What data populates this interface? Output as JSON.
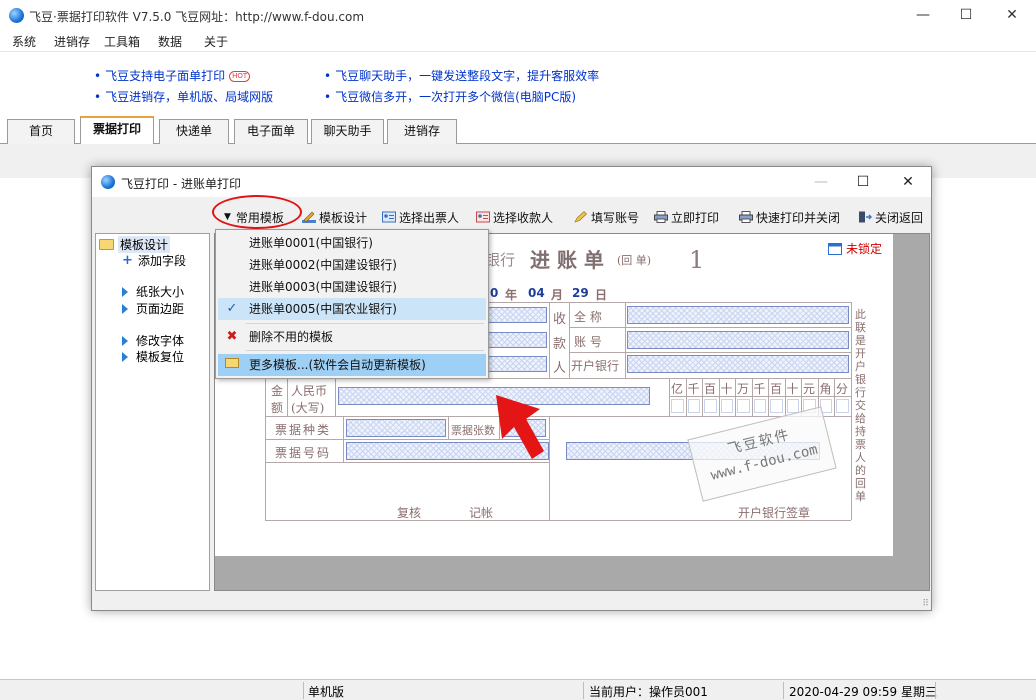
{
  "app": {
    "title": "飞豆·票据打印软件 V7.5.0   飞豆网址：http://www.f-dou.com",
    "minimize": "—",
    "maximize": "☐",
    "close": "✕"
  },
  "menu": [
    "系统",
    "进销存",
    "工具箱",
    "数据",
    "关于"
  ],
  "ads": [
    {
      "text": "飞豆支持电子面单打印",
      "badge": "HOT"
    },
    {
      "text": "飞豆聊天助手，一键发送整段文字，提升客服效率"
    },
    {
      "text": "飞豆进销存，单机版、局域网版"
    },
    {
      "text": "飞豆微信多开，一次打开多个微信(电脑PC版)"
    }
  ],
  "tabs": [
    "首页",
    "票据打印",
    "快递单",
    "电子面单",
    "聊天助手",
    "进销存"
  ],
  "active_tab": "票据打印",
  "dialog": {
    "title": "飞豆打印 - 进账单打印",
    "toolbar": {
      "common_templates": "常用模板",
      "template_design": "模板设计",
      "select_payer": "选择出票人",
      "select_payee": "选择收款人",
      "fill_account": "填写账号",
      "print_now": "立即打印",
      "quick_print_close": "快速打印并关闭",
      "close_return": "关闭返回"
    },
    "tree": {
      "root": "模板设计",
      "items": [
        "添加字段",
        "纸张大小",
        "页面边距",
        "修改字体",
        "模板复位"
      ]
    },
    "dropdown": {
      "items": [
        "进账单0001(中国银行)",
        "进账单0002(中国建设银行)",
        "进账单0003(中国建设银行)",
        "进账单0005(中国农业银行)"
      ],
      "checked": "进账单0005(中国农业银行)",
      "delete_unused": "删除不用的模板",
      "more_templates": "更多模板...(软件会自动更新模板)"
    },
    "slip": {
      "bank_suffix": "银行",
      "title": "进 账 单",
      "title_note": "(回    单)",
      "copy_no": "1",
      "date_zero": "0",
      "year_label": "年",
      "month": "04",
      "month_label": "月",
      "day": "29",
      "day_label": "日",
      "payee_side": [
        "收",
        "款",
        "人"
      ],
      "full_name": "全    称",
      "account_no": "账    号",
      "bank_of_deposit": "开户银行",
      "amount_label": [
        "金",
        "额"
      ],
      "rmb_label": "人民币",
      "rmb_upper": "(大写)",
      "digits": [
        "亿",
        "千",
        "百",
        "十",
        "万",
        "千",
        "百",
        "十",
        "元",
        "角",
        "分"
      ],
      "bill_type": "票据种类",
      "bill_count": "票据张数",
      "bill_no": "票据号码",
      "review": "复核",
      "bookkeeping": "记帐",
      "bank_signature": "开户银行签章",
      "side_note": "此联是开户银行交给持票人的回单",
      "unlocked": "未锁定"
    },
    "watermark": [
      "飞豆软件",
      "www.f-dou.com"
    ]
  },
  "status": {
    "edition": "单机版",
    "user": "当前用户：操作员001",
    "datetime": "2020-04-29  09:59  星期三"
  },
  "colors": {
    "link": "#0033cc",
    "highlight": "#9ecff5",
    "annotation_red": "#e01414",
    "date_blue": "#1f3f9d"
  }
}
